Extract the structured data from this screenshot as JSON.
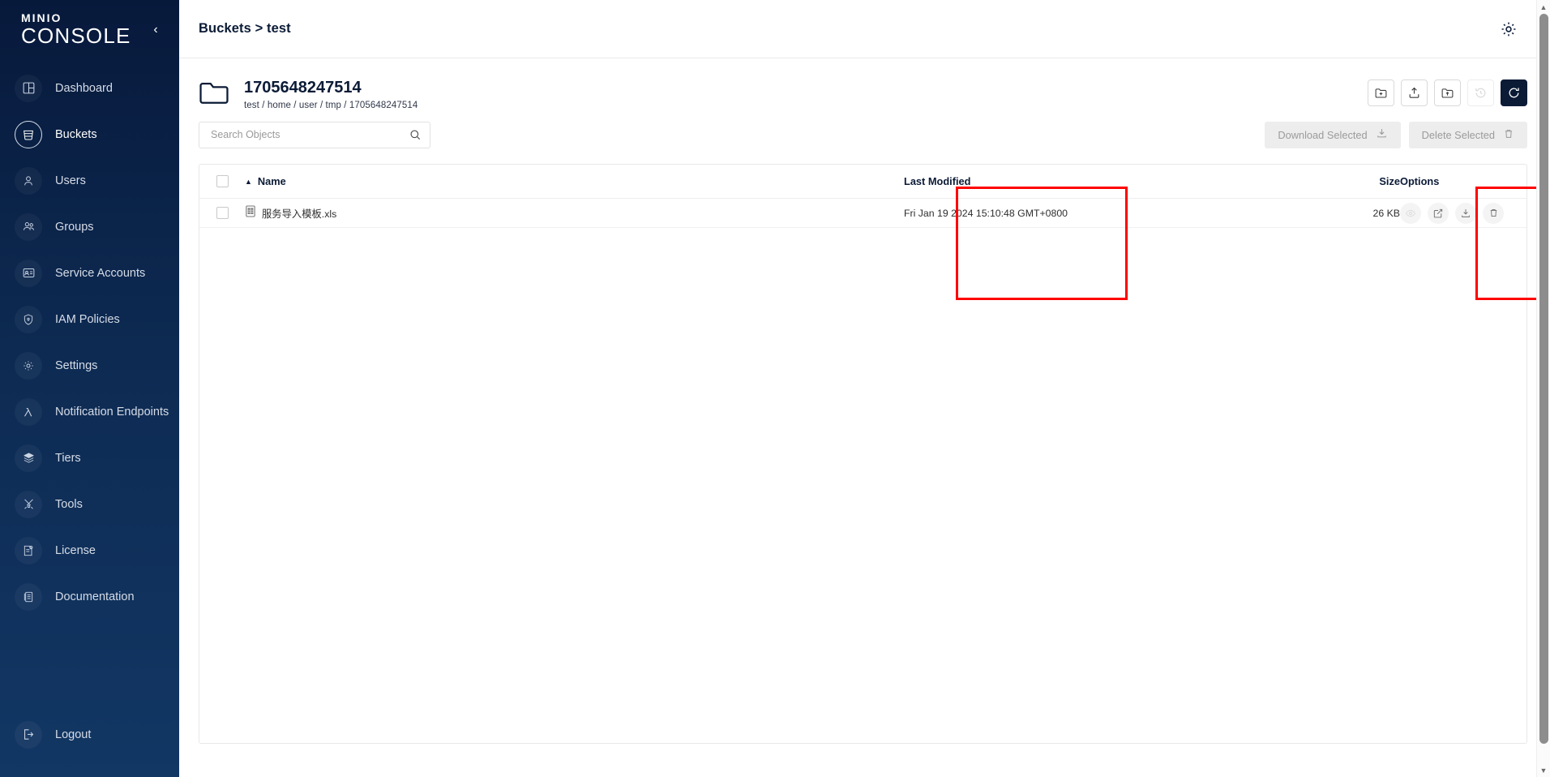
{
  "sidebar": {
    "brand_line1": "MINIO",
    "brand_line2": "CONSOLE",
    "collapse_label": "‹",
    "items": [
      {
        "label": "Dashboard",
        "icon": "dashboard-icon",
        "active": false
      },
      {
        "label": "Buckets",
        "icon": "bucket-icon",
        "active": true
      },
      {
        "label": "Users",
        "icon": "user-icon",
        "active": false
      },
      {
        "label": "Groups",
        "icon": "groups-icon",
        "active": false
      },
      {
        "label": "Service Accounts",
        "icon": "service-account-icon",
        "active": false
      },
      {
        "label": "IAM Policies",
        "icon": "shield-icon",
        "active": false
      },
      {
        "label": "Settings",
        "icon": "gear-icon",
        "active": false
      },
      {
        "label": "Notification Endpoints",
        "icon": "lambda-icon",
        "active": false
      },
      {
        "label": "Tiers",
        "icon": "layers-icon",
        "active": false
      },
      {
        "label": "Tools",
        "icon": "tools-icon",
        "active": false
      },
      {
        "label": "License",
        "icon": "license-icon",
        "active": false
      },
      {
        "label": "Documentation",
        "icon": "book-icon",
        "active": false
      }
    ],
    "logout": {
      "label": "Logout",
      "icon": "logout-icon"
    }
  },
  "topbar": {
    "breadcrumb": "Buckets > test",
    "settings_icon": "gear-icon"
  },
  "object_browser": {
    "folder_icon": "folder-icon",
    "title": "1705648247514",
    "path": "test / home / user / tmp / 1705648247514",
    "actions": [
      {
        "name": "create-new-path-button",
        "icon": "folder-plus-icon",
        "state": "enabled"
      },
      {
        "name": "upload-file-button",
        "icon": "upload-icon",
        "state": "enabled"
      },
      {
        "name": "upload-folder-button",
        "icon": "folder-upload-icon",
        "state": "enabled"
      },
      {
        "name": "version-history-button",
        "icon": "history-icon",
        "state": "disabled"
      },
      {
        "name": "refresh-button",
        "icon": "refresh-icon",
        "state": "primary"
      }
    ]
  },
  "search": {
    "placeholder": "Search Objects",
    "value": "",
    "icon": "search-icon"
  },
  "bulk_actions": {
    "download_selected": {
      "label": "Download Selected",
      "icon": "download-icon",
      "disabled": true
    },
    "delete_selected": {
      "label": "Delete Selected",
      "icon": "trash-icon",
      "disabled": true
    }
  },
  "table": {
    "select_all_checkbox": false,
    "sort_column": "Name",
    "sort_direction": "asc",
    "columns": {
      "name": "Name",
      "last_modified": "Last Modified",
      "size": "Size",
      "options": "Options"
    },
    "rows": [
      {
        "checked": false,
        "file_icon": "xls-file-icon",
        "name": "服务导入模板.xls",
        "last_modified": "Fri Jan 19 2024 15:10:48 GMT+0800",
        "size": "26 KB",
        "options": [
          {
            "name": "preview-object-button",
            "icon": "eye-icon",
            "disabled": true
          },
          {
            "name": "share-object-button",
            "icon": "share-icon",
            "disabled": false
          },
          {
            "name": "download-object-button",
            "icon": "download-icon",
            "disabled": false
          },
          {
            "name": "delete-object-button",
            "icon": "trash-icon",
            "disabled": false
          }
        ]
      }
    ]
  },
  "annotations": [
    {
      "name": "highlight-last-modified-column",
      "color": "#fe0000"
    },
    {
      "name": "highlight-size-column",
      "color": "#fe0000"
    }
  ],
  "scrollbar": {
    "up_arrow": "▲",
    "down_arrow": "▼"
  },
  "colors": {
    "sidebar_top": "#07193b",
    "sidebar_bottom": "#123764",
    "accent_dark": "#0b1b36",
    "annotation_red": "#fe0000",
    "disabled_bg": "#ededed"
  }
}
